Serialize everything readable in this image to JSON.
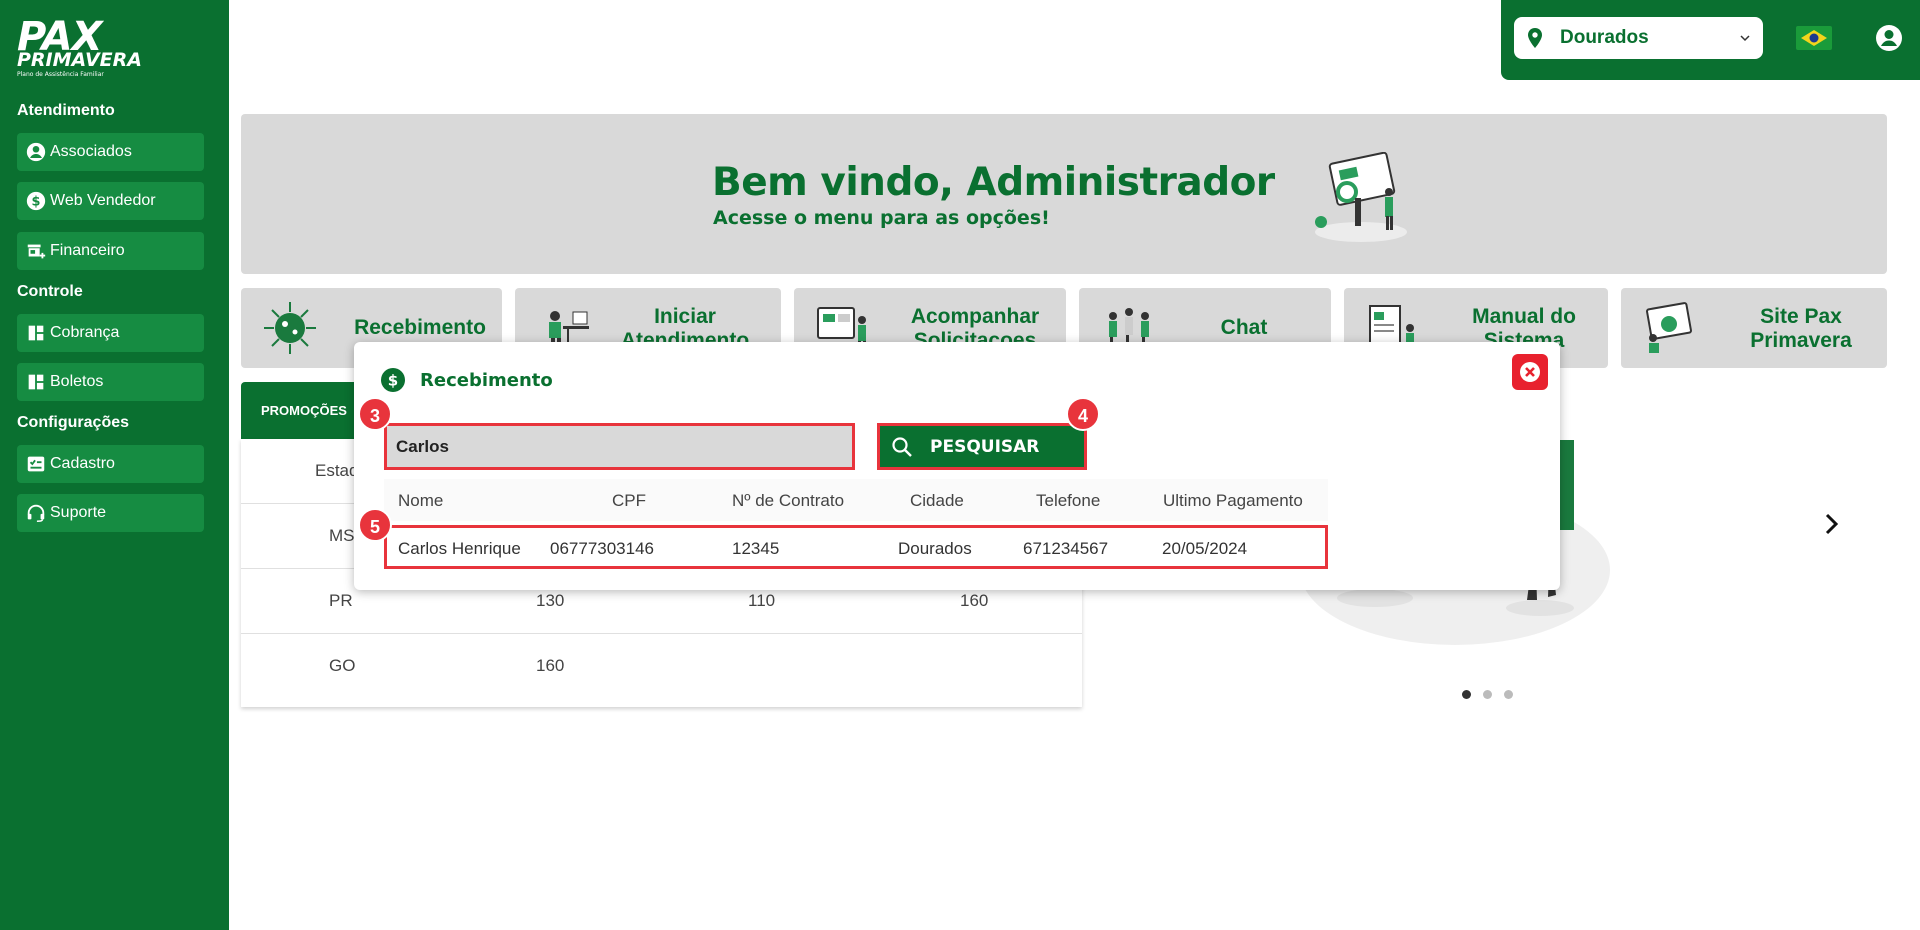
{
  "brand": {
    "logo_main": "PAX",
    "logo_sub": "PRIMAVERA",
    "logo_tagline": "Plano de Assistência Familiar"
  },
  "sidebar": {
    "sections": [
      {
        "title": "Atendimento",
        "items": [
          {
            "label": "Associados",
            "icon": "user-circle-icon"
          },
          {
            "label": "Web Vendedor",
            "icon": "dollar-circle-icon"
          },
          {
            "label": "Financeiro",
            "icon": "store-plus-icon"
          }
        ]
      },
      {
        "title": "Controle",
        "items": [
          {
            "label": "Cobrança",
            "icon": "layout-icon"
          },
          {
            "label": "Boletos",
            "icon": "layout-icon"
          }
        ]
      },
      {
        "title": "Configurações",
        "items": [
          {
            "label": "Cadastro",
            "icon": "form-icon"
          },
          {
            "label": "Suporte",
            "icon": "headset-icon"
          }
        ]
      }
    ]
  },
  "topbar": {
    "city": "Dourados",
    "accent": "#0a7030"
  },
  "banner": {
    "title": "Bem vindo, Administrador",
    "subtitle": "Acesse o menu para as opções!"
  },
  "cards": [
    "Recebimento",
    "Iniciar Atendimento",
    "Acompanhar Solicitacoes",
    "Chat",
    "Manual do Sistema",
    "Site Pax Primavera"
  ],
  "promo_table": {
    "tab_label": "PROMOÇÕES",
    "header_first": "Estad",
    "rows": [
      [
        "MS",
        "",
        "",
        ""
      ],
      [
        "PR",
        "130",
        "110",
        "160"
      ],
      [
        "GO",
        "160",
        "",
        ""
      ]
    ]
  },
  "modal": {
    "title": "Recebimento",
    "search_value": "Carlos",
    "search_button": "PESQUISAR",
    "columns": [
      "Nome",
      "CPF",
      "Nº de Contrato",
      "Cidade",
      "Telefone",
      "Ultimo Pagamento"
    ],
    "rows": [
      [
        "Carlos Henrique",
        "06777303146",
        "12345",
        "Dourados",
        "671234567",
        "20/05/2024"
      ]
    ]
  },
  "annotations": [
    "3",
    "4",
    "5"
  ],
  "colors": {
    "primary": "#0a7030",
    "highlight": "#e8343c",
    "close": "#e8212e"
  }
}
